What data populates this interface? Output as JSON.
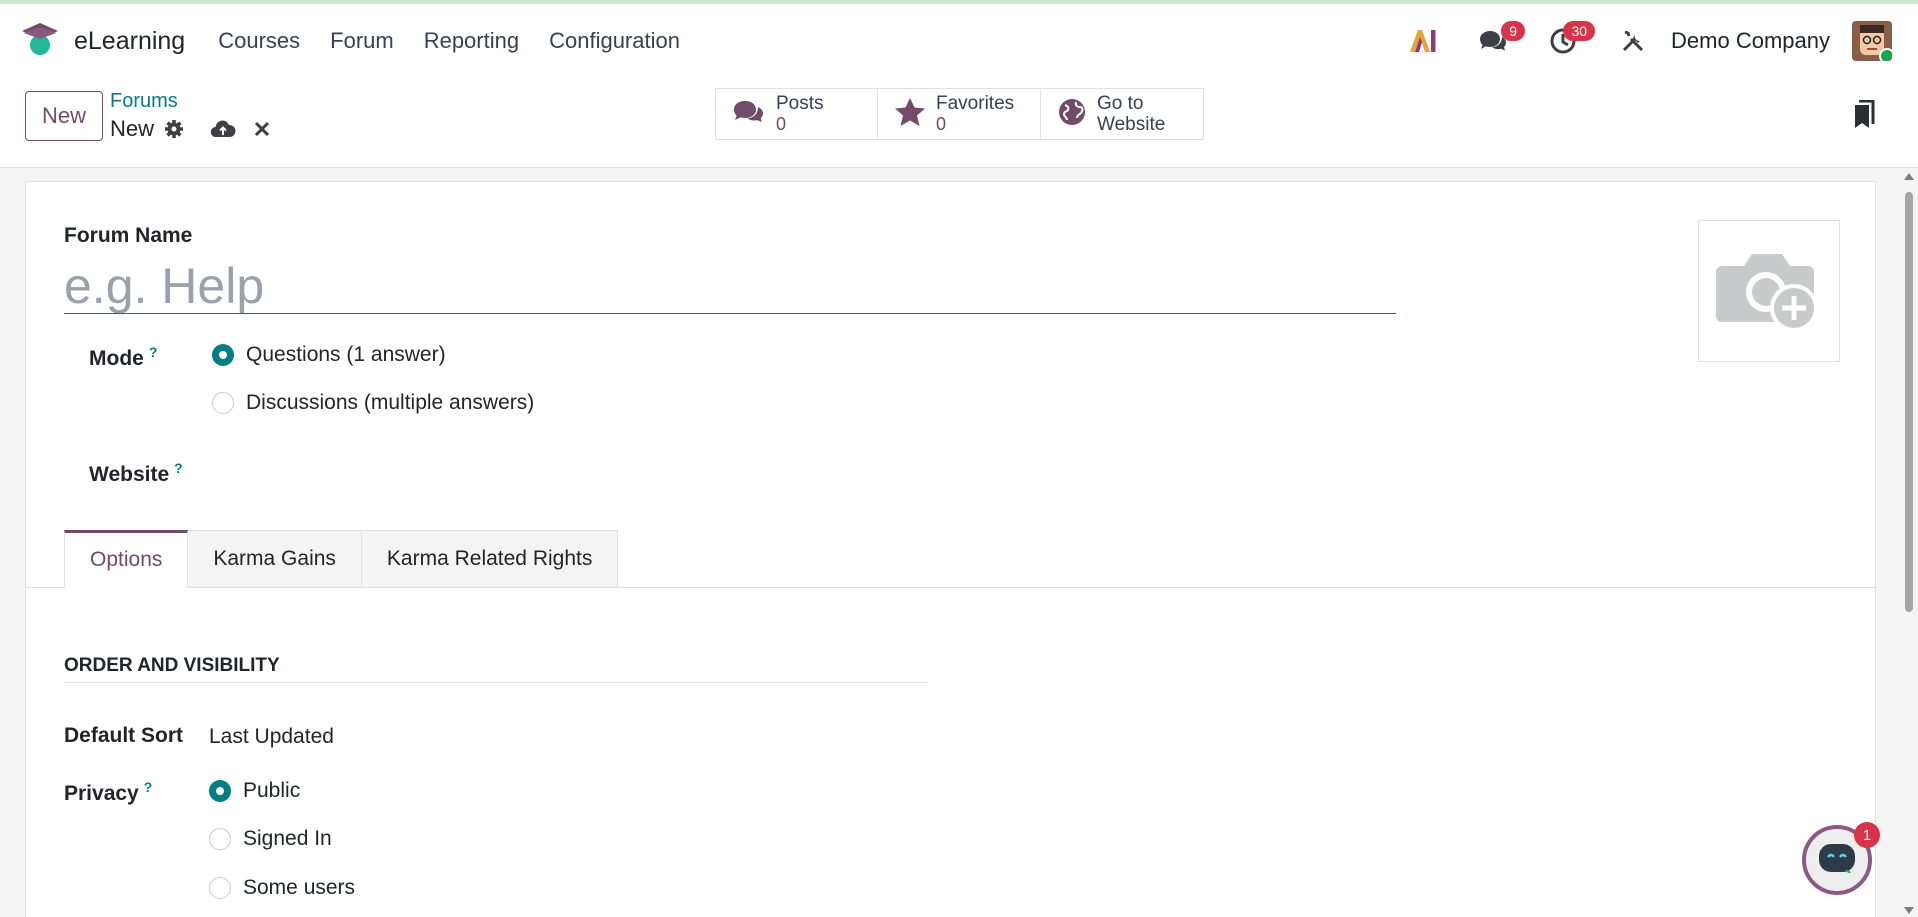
{
  "colors": {
    "brand": "#714b67",
    "accent": "#017e84",
    "badge": "#d9334a"
  },
  "navbar": {
    "app_name": "eLearning",
    "menu": [
      "Courses",
      "Forum",
      "Reporting",
      "Configuration"
    ],
    "messages_count": "9",
    "activities_count": "30",
    "company": "Demo Company"
  },
  "control": {
    "new_label": "New",
    "breadcrumb": "Forums",
    "record_title": "New",
    "stats": [
      {
        "label": "Posts",
        "value": "0",
        "icon": "comments-icon"
      },
      {
        "label": "Favorites",
        "value": "0",
        "icon": "star-icon"
      },
      {
        "label": "Go to",
        "value": "Website",
        "icon": "globe-icon"
      }
    ]
  },
  "form": {
    "name_label": "Forum Name",
    "name_placeholder": "e.g. Help",
    "mode_label": "Mode",
    "help_mark": "?",
    "mode_options": [
      "Questions (1 answer)",
      "Discussions (multiple answers)"
    ],
    "mode_selected": 0,
    "website_label": "Website",
    "tabs": [
      "Options",
      "Karma Gains",
      "Karma Related Rights"
    ],
    "active_tab": 0,
    "section_title": "ORDER AND VISIBILITY",
    "default_sort_label": "Default Sort",
    "default_sort_value": "Last Updated",
    "privacy_label": "Privacy",
    "privacy_options": [
      "Public",
      "Signed In",
      "Some users"
    ],
    "privacy_selected": 0
  },
  "chat": {
    "badge": "1"
  }
}
